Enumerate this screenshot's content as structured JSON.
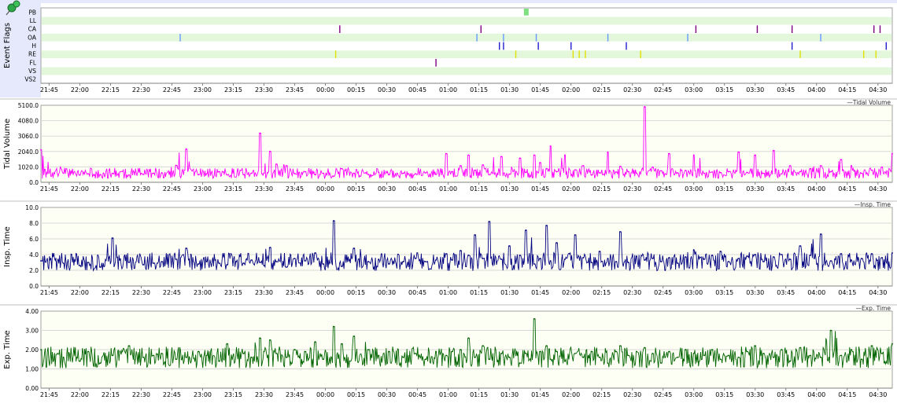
{
  "x_ticks": [
    "21:45",
    "22:00",
    "22:15",
    "22:30",
    "22:45",
    "23:00",
    "23:15",
    "23:30",
    "23:45",
    "00:00",
    "00:15",
    "00:30",
    "00:45",
    "01:00",
    "01:15",
    "01:30",
    "01:45",
    "02:00",
    "02:15",
    "02:30",
    "02:45",
    "03:00",
    "03:15",
    "03:30",
    "03:45",
    "04:00",
    "04:15",
    "04:30"
  ],
  "panels": {
    "events": {
      "ylabel": "Event Flags",
      "row_labels": [
        "PB",
        "LL",
        "CA",
        "OA",
        "H",
        "RE",
        "FL",
        "VS",
        "VS2"
      ]
    },
    "tidal": {
      "ylabel": "Tidal Volume",
      "legend": "Tidal Volume",
      "y_ticks": [
        "0.0",
        "1020.0",
        "2040.0",
        "3060.0",
        "4080.0",
        "5100.0"
      ]
    },
    "insp": {
      "ylabel": "Insp. Time",
      "legend": "Insp. Time",
      "y_ticks": [
        "0.0",
        "2.0",
        "4.0",
        "6.0",
        "8.0",
        "10.0"
      ]
    },
    "exp": {
      "ylabel": "Exp. Time",
      "legend": "Exp. Time",
      "y_ticks": [
        "0.00",
        "1.00",
        "2.00",
        "3.00",
        "4.00"
      ]
    }
  },
  "colors": {
    "tidal": "#ff00ff",
    "insp": "#000080",
    "exp": "#006400",
    "event_row_band": "#e3f8da",
    "plot_bg": "#fefff4",
    "event_area_bg": "#ffffff",
    "grid": "#d8d8d8",
    "left_strip": "#e5e9fb",
    "pb_marker": "#7ee07e",
    "ca": "#800080",
    "oa": "#6699ff",
    "h": "#2020d0",
    "re": "#e0e000",
    "fl": "#800080"
  },
  "chart_data": [
    {
      "type": "event-flags",
      "ylabel": "Event Flags",
      "categories": [
        "PB",
        "LL",
        "CA",
        "OA",
        "H",
        "RE",
        "FL",
        "VS",
        "VS2"
      ],
      "x_range": [
        "21:41",
        "04:37"
      ],
      "events": {
        "PB": [
          {
            "start": "01:37",
            "end": "01:39"
          }
        ],
        "LL": [],
        "CA": [
          "00:07",
          "01:16",
          "03:01",
          "03:31",
          "03:48",
          "04:28",
          "04:31"
        ],
        "OA": [
          "22:49",
          "01:14",
          "01:27",
          "01:43",
          "02:18",
          "02:57",
          "04:02"
        ],
        "H": [
          "01:25",
          "01:27",
          "01:44",
          "02:00",
          "02:27",
          "03:48",
          "04:34"
        ],
        "RE": [
          "00:05",
          "01:33",
          "02:01",
          "02:04",
          "02:07",
          "02:34",
          "03:52",
          "04:23",
          "04:29"
        ],
        "FL": [
          "00:54"
        ],
        "VS": [],
        "VS2": []
      }
    },
    {
      "type": "line",
      "ylabel": "Tidal Volume",
      "legend": "Tidal Volume",
      "ylim": [
        0,
        5100
      ],
      "y_ticks": [
        0,
        1020,
        2040,
        3060,
        4080,
        5100
      ],
      "x_range": [
        "21:41",
        "04:37"
      ],
      "x": [
        "21:41",
        "21:52",
        "22:00",
        "22:04",
        "22:10",
        "22:16",
        "22:24",
        "22:31",
        "22:36",
        "22:40",
        "22:47",
        "22:52",
        "22:58",
        "23:02",
        "23:08",
        "23:12",
        "23:20",
        "23:24",
        "23:28",
        "23:30",
        "23:33",
        "23:36",
        "23:41",
        "23:45",
        "23:50",
        "23:55",
        "23:59",
        "00:04",
        "00:08",
        "00:14",
        "00:21",
        "00:26",
        "00:31",
        "00:38",
        "00:44",
        "00:49",
        "00:54",
        "00:59",
        "01:02",
        "01:06",
        "01:10",
        "01:13",
        "01:17",
        "01:20",
        "01:26",
        "01:30",
        "01:35",
        "01:38",
        "01:42",
        "01:45",
        "01:48",
        "01:50",
        "01:53",
        "01:57",
        "02:02",
        "02:06",
        "02:10",
        "02:14",
        "02:18",
        "02:22",
        "02:24",
        "02:28",
        "02:32",
        "02:36",
        "02:40",
        "02:44",
        "02:46",
        "02:48",
        "02:52",
        "02:56",
        "03:00",
        "03:05",
        "03:09",
        "03:13",
        "03:17",
        "03:22",
        "03:26",
        "03:30",
        "03:34",
        "03:39",
        "03:43",
        "03:47",
        "03:52",
        "03:57",
        "04:02",
        "04:07",
        "04:12",
        "04:17",
        "04:22",
        "04:27",
        "04:32",
        "04:37"
      ],
      "values": [
        2150,
        600,
        480,
        560,
        500,
        590,
        480,
        520,
        600,
        620,
        1120,
        2200,
        500,
        560,
        700,
        490,
        520,
        600,
        3250,
        600,
        2050,
        1200,
        1100,
        580,
        700,
        500,
        600,
        400,
        900,
        600,
        520,
        660,
        500,
        600,
        560,
        620,
        520,
        1900,
        700,
        1100,
        1800,
        800,
        1150,
        500,
        1700,
        540,
        1600,
        650,
        1800,
        1300,
        900,
        2400,
        700,
        1800,
        820,
        1100,
        480,
        620,
        2000,
        680,
        1050,
        700,
        600,
        5000,
        1000,
        760,
        560,
        1900,
        620,
        780,
        1800,
        600,
        680,
        640,
        700,
        2000,
        650,
        1800,
        600,
        2100,
        560,
        1100,
        700,
        900,
        1100,
        700,
        1500,
        1100,
        600,
        800,
        1000,
        1900
      ]
    },
    {
      "type": "line",
      "ylabel": "Insp. Time",
      "legend": "Insp. Time",
      "ylim": [
        0,
        10
      ],
      "y_ticks": [
        0,
        2,
        4,
        6,
        8,
        10
      ],
      "x_range": [
        "21:41",
        "04:37"
      ],
      "x": [
        "21:41",
        "21:52",
        "22:00",
        "22:04",
        "22:10",
        "22:16",
        "22:24",
        "22:31",
        "22:36",
        "22:40",
        "22:47",
        "22:52",
        "22:58",
        "23:02",
        "23:08",
        "23:12",
        "23:20",
        "23:24",
        "23:28",
        "23:30",
        "23:33",
        "23:36",
        "23:41",
        "23:45",
        "23:50",
        "23:55",
        "23:59",
        "00:04",
        "00:08",
        "00:14",
        "00:21",
        "00:26",
        "00:31",
        "00:38",
        "00:44",
        "00:49",
        "00:54",
        "00:59",
        "01:02",
        "01:06",
        "01:10",
        "01:13",
        "01:17",
        "01:20",
        "01:26",
        "01:30",
        "01:35",
        "01:38",
        "01:42",
        "01:45",
        "01:48",
        "01:50",
        "01:53",
        "01:57",
        "02:02",
        "02:06",
        "02:10",
        "02:14",
        "02:18",
        "02:22",
        "02:24",
        "02:28",
        "02:32",
        "02:36",
        "02:40",
        "02:44",
        "02:46",
        "02:48",
        "02:52",
        "02:56",
        "03:00",
        "03:05",
        "03:09",
        "03:13",
        "03:17",
        "03:22",
        "03:26",
        "03:30",
        "03:34",
        "03:39",
        "03:43",
        "03:47",
        "03:52",
        "03:57",
        "04:02",
        "04:07",
        "04:12",
        "04:17",
        "04:22",
        "04:27",
        "04:32",
        "04:37"
      ],
      "values": [
        3.2,
        2.9,
        2.6,
        3.0,
        2.4,
        6.1,
        3.0,
        2.7,
        2.9,
        3.1,
        3.4,
        4.8,
        2.8,
        3.1,
        2.9,
        2.7,
        2.9,
        3.3,
        3.0,
        2.6,
        4.9,
        3.1,
        2.4,
        3.5,
        3.2,
        4.2,
        2.8,
        8.3,
        2.5,
        4.8,
        3.1,
        3.4,
        2.8,
        3.1,
        3.5,
        3.1,
        3.3,
        4.1,
        3.3,
        4.5,
        3.9,
        6.5,
        3.5,
        8.2,
        3.4,
        5.1,
        3.9,
        7.1,
        2.8,
        3.5,
        7.7,
        3.2,
        5.5,
        3.4,
        6.5,
        3.6,
        3.0,
        4.4,
        3.5,
        3.1,
        6.9,
        3.0,
        3.8,
        3.3,
        3.5,
        3.1,
        2.0,
        3.6,
        2.9,
        3.7,
        4.6,
        3.4,
        3.9,
        4.4,
        3.1,
        3.5,
        3.8,
        4.0,
        3.1,
        3.7,
        4.0,
        3.4,
        5.1,
        3.9,
        6.6,
        3.2,
        4.1,
        3.3,
        3.5,
        4.1,
        3.6,
        4.2
      ]
    },
    {
      "type": "line",
      "ylabel": "Exp. Time",
      "legend": "Exp. Time",
      "ylim": [
        0,
        4
      ],
      "y_ticks": [
        0,
        1,
        2,
        3,
        4
      ],
      "x_range": [
        "21:41",
        "04:37"
      ],
      "x": [
        "21:41",
        "21:52",
        "22:00",
        "22:04",
        "22:10",
        "22:16",
        "22:24",
        "22:31",
        "22:36",
        "22:40",
        "22:47",
        "22:52",
        "22:58",
        "23:02",
        "23:08",
        "23:12",
        "23:20",
        "23:24",
        "23:28",
        "23:30",
        "23:33",
        "23:36",
        "23:41",
        "23:45",
        "23:50",
        "23:55",
        "23:59",
        "00:04",
        "00:08",
        "00:14",
        "00:21",
        "00:26",
        "00:31",
        "00:38",
        "00:44",
        "00:49",
        "00:54",
        "00:59",
        "01:02",
        "01:06",
        "01:10",
        "01:13",
        "01:17",
        "01:20",
        "01:26",
        "01:30",
        "01:35",
        "01:38",
        "01:42",
        "01:45",
        "01:48",
        "01:50",
        "01:53",
        "01:57",
        "02:02",
        "02:06",
        "02:10",
        "02:14",
        "02:18",
        "02:22",
        "02:24",
        "02:28",
        "02:32",
        "02:36",
        "02:40",
        "02:44",
        "02:46",
        "02:48",
        "02:52",
        "02:56",
        "03:00",
        "03:05",
        "03:09",
        "03:13",
        "03:17",
        "03:22",
        "03:26",
        "03:30",
        "03:34",
        "03:39",
        "03:43",
        "03:47",
        "03:52",
        "03:57",
        "04:02",
        "04:07",
        "04:12",
        "04:17",
        "04:22",
        "04:27",
        "04:32",
        "04:37"
      ],
      "values": [
        2.0,
        1.6,
        1.4,
        1.9,
        1.3,
        1.7,
        2.2,
        1.6,
        1.7,
        1.8,
        1.5,
        1.6,
        1.9,
        1.7,
        1.4,
        2.3,
        1.8,
        1.6,
        2.6,
        1.9,
        2.5,
        1.8,
        1.6,
        2.0,
        1.9,
        2.4,
        1.5,
        3.2,
        2.3,
        2.7,
        2.0,
        1.7,
        1.9,
        1.6,
        1.8,
        1.5,
        1.9,
        1.7,
        1.9,
        2.0,
        2.6,
        1.6,
        2.2,
        1.5,
        1.8,
        1.6,
        1.3,
        1.8,
        3.6,
        1.9,
        2.2,
        1.5,
        1.9,
        1.4,
        1.8,
        1.6,
        1.9,
        1.6,
        1.3,
        1.9,
        2.2,
        1.7,
        1.9,
        2.1,
        1.8,
        1.3,
        1.6,
        1.9,
        1.6,
        2.0,
        1.8,
        1.7,
        2.0,
        1.5,
        1.7,
        1.6,
        1.9,
        2.2,
        1.8,
        1.6,
        2.0,
        1.4,
        2.1,
        1.7,
        1.6,
        3.0,
        1.7,
        2.0,
        1.5,
        2.2,
        1.8,
        2.3
      ]
    }
  ]
}
